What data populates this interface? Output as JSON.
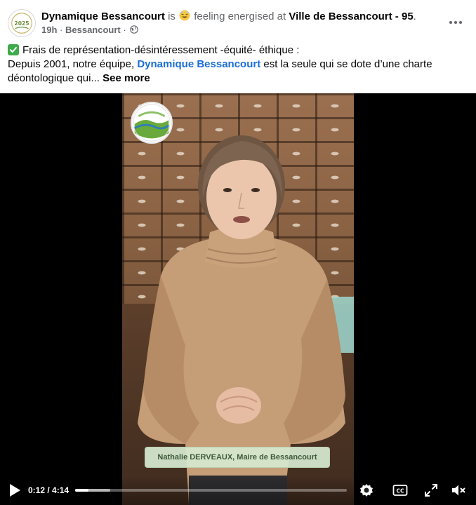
{
  "post": {
    "author": "Dynamique Bessancourt",
    "verb": "is",
    "feeling": "feeling energised at",
    "place": "Ville de Bessancourt - 95",
    "place_suffix": ".",
    "time": "19h",
    "separator": "·",
    "location": "Bessancourt",
    "privacy_icon": "globe-icon",
    "more_icon": "more-options-icon"
  },
  "body": {
    "line1": "Frais de représentation-désintéressement -équité- éthique :",
    "line2_pre": "Depuis 2001, notre équipe, ",
    "mention": "Dynamique Bessancourt",
    "line2_post": " est la seule  qui se dote d’une charte",
    "line3": "déontologique qui... ",
    "see_more": "See more"
  },
  "video": {
    "caption": "Nathalie DERVEAUX, Maire de Bessancourt",
    "time_display": "0:12 / 4:14",
    "progress": 0.048,
    "buffered": 0.13,
    "play_icon": "play-icon",
    "settings_icon": "settings-gear-icon",
    "captions_icon": "closed-captions-icon",
    "fullscreen_icon": "fullscreen-icon",
    "mute_icon": "volume-muted-icon"
  },
  "colors": {
    "mention": "#1a6ed8",
    "check": "#3eaa4b",
    "muted_text": "#65676b"
  }
}
